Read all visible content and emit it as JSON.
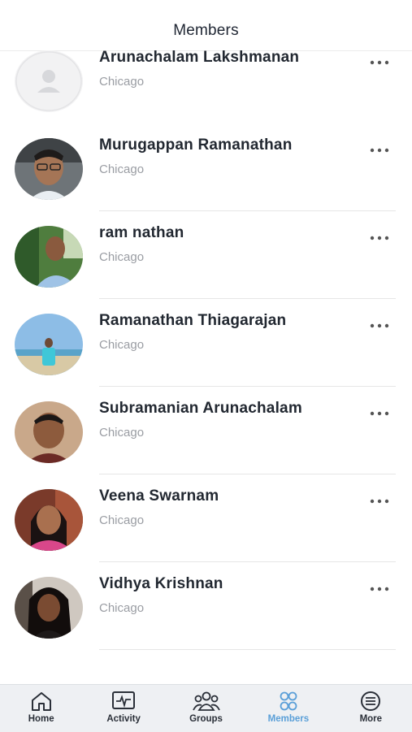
{
  "header": {
    "title": "Members"
  },
  "members": [
    {
      "name": "Arunachalam Lakshmanan",
      "city": "Chicago",
      "avatar": "placeholder-avatar"
    },
    {
      "name": "Murugappan Ramanathan",
      "city": "Chicago",
      "avatar": "photo"
    },
    {
      "name": "ram nathan",
      "city": "Chicago",
      "avatar": "photo"
    },
    {
      "name": "Ramanathan Thiagarajan",
      "city": "Chicago",
      "avatar": "photo"
    },
    {
      "name": "Subramanian Arunachalam",
      "city": "Chicago",
      "avatar": "photo"
    },
    {
      "name": "Veena Swarnam",
      "city": "Chicago",
      "avatar": "photo"
    },
    {
      "name": "Vidhya Krishnan",
      "city": "Chicago",
      "avatar": "photo"
    }
  ],
  "tabbar": {
    "tabs": [
      {
        "label": "Home",
        "icon": "home-icon"
      },
      {
        "label": "Activity",
        "icon": "activity-icon"
      },
      {
        "label": "Groups",
        "icon": "groups-icon"
      },
      {
        "label": "Members",
        "icon": "members-icon",
        "active": true
      },
      {
        "label": "More",
        "icon": "more-icon"
      }
    ]
  },
  "colors": {
    "accent": "#5a9fd8",
    "text": "#222831",
    "subtext": "#9a9da3",
    "tabbar_bg": "#eef0f3"
  }
}
